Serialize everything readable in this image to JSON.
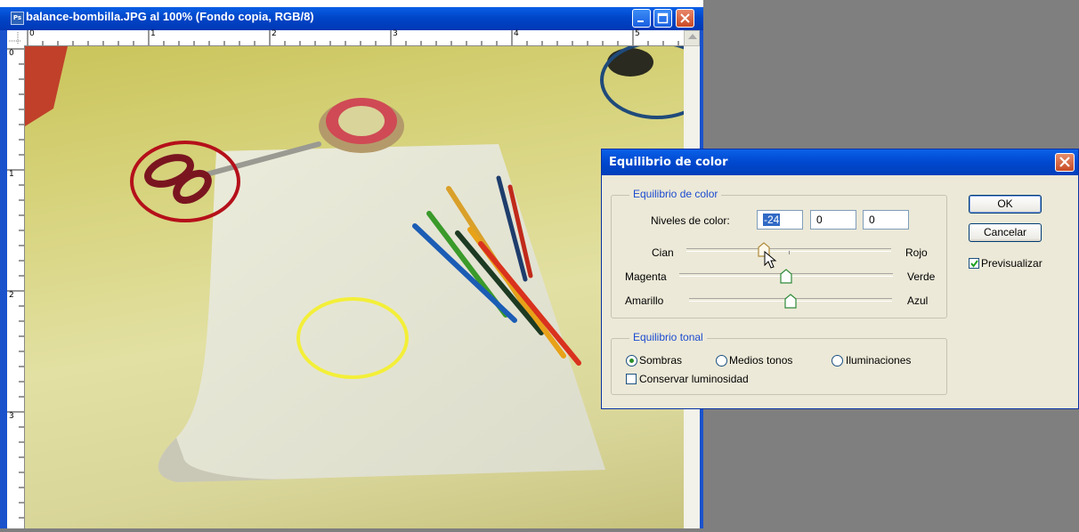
{
  "document": {
    "title": "balance-bombilla.JPG al 100% (Fondo copia, RGB/8)",
    "app_icon": "Ps",
    "ruler_top_labels": [
      "0",
      "1",
      "2",
      "3",
      "4",
      "5"
    ],
    "ruler_left_labels": [
      "0",
      "1",
      "2",
      "3"
    ]
  },
  "dialog": {
    "title": "Equilibrio de color",
    "color_group": {
      "legend": "Equilibrio de color",
      "levels_label": "Niveles de color:",
      "levels": [
        "-24",
        "0",
        "0"
      ],
      "sliders": [
        {
          "left": "Cian",
          "right": "Rojo",
          "value": -24
        },
        {
          "left": "Magenta",
          "right": "Verde",
          "value": 0
        },
        {
          "left": "Amarillo",
          "right": "Azul",
          "value": 0
        }
      ]
    },
    "tonal_group": {
      "legend": "Equilibrio tonal",
      "options": [
        "Sombras",
        "Medios tonos",
        "Iluminaciones"
      ],
      "selected": "Sombras",
      "preserve_label": "Conservar luminosidad",
      "preserve_checked": false
    },
    "ok_label": "OK",
    "cancel_label": "Cancelar",
    "preview_label": "Previsualizar",
    "preview_checked": true
  },
  "colors": {
    "annotation_red": "#b5101a",
    "annotation_blue": "#1f4a7a",
    "annotation_yellow": "#f3ef38"
  }
}
